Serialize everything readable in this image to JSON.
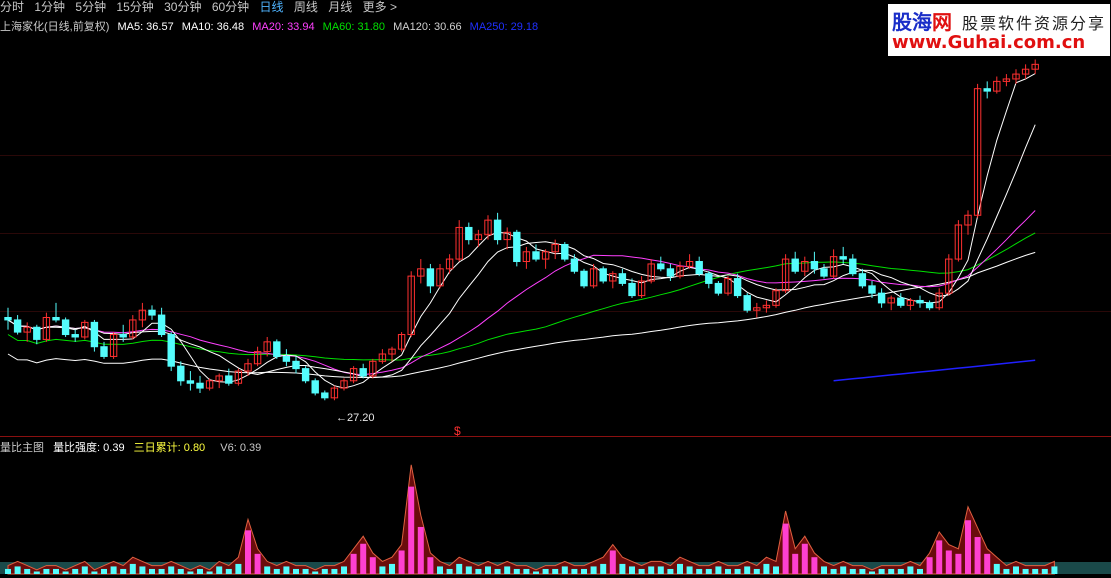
{
  "tabs": [
    {
      "label": "分时",
      "active": false
    },
    {
      "label": "1分钟",
      "active": false
    },
    {
      "label": "5分钟",
      "active": false
    },
    {
      "label": "15分钟",
      "active": false
    },
    {
      "label": "30分钟",
      "active": false
    },
    {
      "label": "60分钟",
      "active": false
    },
    {
      "label": "日线",
      "active": true
    },
    {
      "label": "周线",
      "active": false
    },
    {
      "label": "月线",
      "active": false
    },
    {
      "label": "更多 >",
      "active": false
    }
  ],
  "info": {
    "stock_title": "上海家化(日线,前复权)",
    "ma5": "MA5: 36.57",
    "ma10": "MA10: 36.48",
    "ma20": "MA20: 33.94",
    "ma60": "MA60: 31.80",
    "ma120": "MA120: 30.66",
    "ma250": "MA250: 29.18"
  },
  "indicator": {
    "name": "量比主图",
    "strength": "量比强度: 0.39",
    "cum3": "三日累计: 0.80",
    "v6": "V6: 0.39"
  },
  "annotations": {
    "low_label": "27.20",
    "dollar_mark": "$"
  },
  "logo": {
    "brand_a": "股海",
    "brand_b": "网",
    "slogan": "股票软件资源分享",
    "url": "www.Guhai.com.cn"
  },
  "colors": {
    "up": "#ff3030",
    "down": "#54fcfc",
    "ma5": "#ffffff",
    "ma10": "#ffff00",
    "ma20": "#ff40ff",
    "ma60": "#00e000",
    "ma120": "#ffffff",
    "ma250": "#2020ff"
  },
  "chart_data": {
    "type": "candlestick",
    "title": "上海家化(日线,前复权)",
    "min_label": 27.2,
    "candles_ohlc": [
      [
        30.6,
        31.0,
        30.1,
        30.5
      ],
      [
        30.5,
        30.7,
        29.9,
        30.0
      ],
      [
        30.0,
        30.4,
        29.6,
        30.2
      ],
      [
        30.2,
        30.3,
        29.5,
        29.7
      ],
      [
        29.7,
        30.8,
        29.6,
        30.6
      ],
      [
        30.6,
        31.2,
        30.4,
        30.5
      ],
      [
        30.5,
        30.6,
        29.8,
        29.9
      ],
      [
        29.9,
        30.1,
        29.6,
        29.8
      ],
      [
        29.8,
        30.5,
        29.7,
        30.4
      ],
      [
        30.4,
        30.5,
        29.2,
        29.4
      ],
      [
        29.4,
        29.6,
        28.9,
        29.0
      ],
      [
        29.0,
        30.0,
        28.9,
        29.9
      ],
      [
        29.9,
        30.3,
        29.6,
        29.8
      ],
      [
        29.8,
        30.7,
        29.7,
        30.5
      ],
      [
        30.5,
        31.2,
        30.2,
        30.9
      ],
      [
        30.9,
        31.1,
        30.5,
        30.7
      ],
      [
        30.7,
        31.0,
        29.8,
        29.9
      ],
      [
        29.9,
        30.0,
        28.4,
        28.6
      ],
      [
        28.6,
        28.8,
        27.8,
        28.0
      ],
      [
        28.0,
        28.4,
        27.6,
        27.9
      ],
      [
        27.9,
        28.2,
        27.5,
        27.7
      ],
      [
        27.7,
        28.1,
        27.6,
        28.0
      ],
      [
        28.0,
        28.3,
        27.7,
        28.2
      ],
      [
        28.2,
        28.5,
        27.8,
        27.9
      ],
      [
        27.9,
        28.5,
        27.8,
        28.4
      ],
      [
        28.4,
        28.9,
        28.2,
        28.7
      ],
      [
        28.7,
        29.4,
        28.6,
        29.2
      ],
      [
        29.2,
        29.8,
        29.0,
        29.6
      ],
      [
        29.6,
        29.7,
        28.9,
        29.0
      ],
      [
        29.0,
        29.3,
        28.6,
        28.8
      ],
      [
        28.8,
        29.0,
        28.3,
        28.5
      ],
      [
        28.5,
        28.6,
        27.9,
        28.0
      ],
      [
        28.0,
        28.1,
        27.4,
        27.5
      ],
      [
        27.5,
        27.6,
        27.2,
        27.3
      ],
      [
        27.3,
        27.8,
        27.2,
        27.7
      ],
      [
        27.7,
        28.1,
        27.6,
        28.0
      ],
      [
        28.0,
        28.6,
        27.9,
        28.5
      ],
      [
        28.5,
        28.7,
        28.1,
        28.2
      ],
      [
        28.2,
        28.9,
        28.1,
        28.8
      ],
      [
        28.8,
        29.3,
        28.7,
        29.1
      ],
      [
        29.1,
        29.4,
        28.8,
        29.3
      ],
      [
        29.3,
        30.0,
        29.2,
        29.9
      ],
      [
        29.9,
        32.5,
        29.8,
        32.3
      ],
      [
        32.3,
        33.0,
        32.0,
        32.6
      ],
      [
        32.6,
        32.8,
        31.6,
        31.9
      ],
      [
        31.9,
        32.8,
        31.8,
        32.6
      ],
      [
        32.6,
        33.2,
        32.4,
        33.0
      ],
      [
        33.0,
        34.6,
        32.9,
        34.3
      ],
      [
        34.3,
        34.5,
        33.6,
        33.8
      ],
      [
        33.8,
        34.2,
        33.5,
        34.0
      ],
      [
        34.0,
        34.8,
        33.8,
        34.6
      ],
      [
        34.6,
        34.9,
        33.6,
        33.8
      ],
      [
        33.8,
        34.3,
        33.4,
        34.1
      ],
      [
        34.1,
        34.2,
        32.7,
        32.9
      ],
      [
        32.9,
        33.5,
        32.6,
        33.3
      ],
      [
        33.3,
        33.6,
        32.9,
        33.0
      ],
      [
        33.0,
        33.4,
        32.6,
        33.3
      ],
      [
        33.3,
        33.8,
        33.0,
        33.6
      ],
      [
        33.6,
        33.7,
        32.9,
        33.0
      ],
      [
        33.0,
        33.2,
        32.4,
        32.5
      ],
      [
        32.5,
        32.6,
        31.8,
        31.9
      ],
      [
        31.9,
        32.8,
        31.8,
        32.6
      ],
      [
        32.6,
        32.7,
        32.0,
        32.1
      ],
      [
        32.1,
        32.5,
        31.8,
        32.4
      ],
      [
        32.4,
        32.6,
        31.9,
        32.0
      ],
      [
        32.0,
        32.2,
        31.4,
        31.5
      ],
      [
        31.5,
        32.3,
        31.4,
        32.1
      ],
      [
        32.1,
        33.0,
        32.0,
        32.8
      ],
      [
        32.8,
        33.1,
        32.5,
        32.6
      ],
      [
        32.6,
        32.8,
        32.1,
        32.3
      ],
      [
        32.3,
        32.9,
        32.2,
        32.7
      ],
      [
        32.7,
        33.2,
        32.6,
        32.9
      ],
      [
        32.9,
        33.1,
        32.3,
        32.4
      ],
      [
        32.4,
        32.5,
        31.8,
        32.0
      ],
      [
        32.0,
        32.1,
        31.5,
        31.6
      ],
      [
        31.6,
        32.3,
        31.5,
        32.2
      ],
      [
        32.2,
        32.4,
        31.4,
        31.5
      ],
      [
        31.5,
        31.6,
        30.8,
        30.9
      ],
      [
        30.9,
        31.2,
        30.6,
        31.0
      ],
      [
        31.0,
        31.3,
        30.8,
        31.1
      ],
      [
        31.1,
        31.8,
        31.0,
        31.7
      ],
      [
        31.7,
        33.2,
        31.6,
        33.0
      ],
      [
        33.0,
        33.3,
        32.4,
        32.5
      ],
      [
        32.5,
        33.1,
        32.3,
        32.9
      ],
      [
        32.9,
        33.3,
        32.4,
        32.6
      ],
      [
        32.6,
        32.8,
        32.2,
        32.3
      ],
      [
        32.3,
        33.4,
        32.2,
        33.1
      ],
      [
        33.1,
        33.5,
        32.8,
        33.0
      ],
      [
        33.0,
        33.2,
        32.3,
        32.4
      ],
      [
        32.4,
        32.6,
        31.8,
        31.9
      ],
      [
        31.9,
        32.1,
        31.4,
        31.6
      ],
      [
        31.6,
        31.8,
        31.0,
        31.2
      ],
      [
        31.2,
        31.5,
        30.9,
        31.4
      ],
      [
        31.4,
        31.6,
        31.0,
        31.1
      ],
      [
        31.1,
        31.4,
        30.9,
        31.3
      ],
      [
        31.3,
        31.5,
        31.0,
        31.2
      ],
      [
        31.2,
        31.3,
        30.9,
        31.0
      ],
      [
        31.0,
        31.8,
        30.9,
        31.6
      ],
      [
        31.6,
        33.2,
        31.5,
        33.0
      ],
      [
        33.0,
        34.6,
        32.9,
        34.4
      ],
      [
        34.4,
        35.0,
        34.0,
        34.8
      ],
      [
        34.8,
        40.2,
        34.7,
        40.0
      ],
      [
        40.0,
        40.3,
        39.6,
        39.9
      ],
      [
        39.9,
        40.5,
        39.8,
        40.3
      ],
      [
        40.3,
        40.6,
        40.1,
        40.4
      ],
      [
        40.4,
        40.8,
        40.2,
        40.6
      ],
      [
        40.6,
        41.0,
        40.4,
        40.8
      ],
      [
        40.8,
        41.2,
        40.6,
        41.0
      ]
    ],
    "volume_ratio_bars": [
      0.2,
      0.3,
      0.2,
      0.1,
      0.2,
      0.2,
      0.1,
      0.2,
      0.3,
      0.1,
      0.2,
      0.3,
      0.2,
      0.4,
      0.3,
      0.2,
      0.2,
      0.3,
      0.2,
      0.1,
      0.2,
      0.1,
      0.3,
      0.2,
      0.4,
      1.3,
      0.6,
      0.3,
      0.2,
      0.3,
      0.2,
      0.2,
      0.1,
      0.2,
      0.2,
      0.3,
      0.6,
      0.9,
      0.5,
      0.3,
      0.4,
      0.7,
      2.6,
      1.4,
      0.5,
      0.3,
      0.2,
      0.4,
      0.3,
      0.2,
      0.3,
      0.2,
      0.3,
      0.2,
      0.2,
      0.1,
      0.2,
      0.2,
      0.3,
      0.2,
      0.2,
      0.3,
      0.4,
      0.7,
      0.4,
      0.3,
      0.2,
      0.3,
      0.3,
      0.2,
      0.4,
      0.3,
      0.2,
      0.2,
      0.3,
      0.2,
      0.2,
      0.3,
      0.2,
      0.4,
      0.3,
      1.5,
      0.6,
      0.9,
      0.5,
      0.3,
      0.2,
      0.3,
      0.2,
      0.2,
      0.1,
      0.2,
      0.2,
      0.2,
      0.3,
      0.2,
      0.5,
      1.0,
      0.7,
      0.6,
      1.6,
      1.1,
      0.6,
      0.4,
      0.2,
      0.3,
      0.2,
      0.2,
      0.2,
      0.3
    ]
  }
}
